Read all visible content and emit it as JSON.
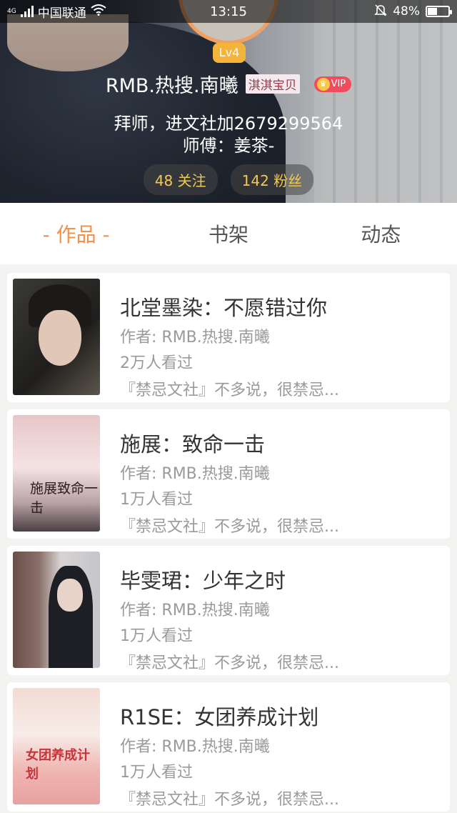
{
  "status_bar": {
    "network": "4G",
    "carrier": "中国联通",
    "time": "13:15",
    "battery_percent": "48%",
    "battery_level": 0.48,
    "icons": [
      "signal-icon",
      "wifi-icon",
      "mute-bell-icon",
      "battery-icon"
    ]
  },
  "profile": {
    "level": "Lv4",
    "username": "RMB.热搜.南曦",
    "nickname_tag": "淇淇宝贝",
    "vip_label": "VIP",
    "bio_line1": "拜师，进文社加2679299564",
    "bio_line2": "师傅：姜茶-",
    "following": "48 关注",
    "followers": "142 粉丝"
  },
  "tabs": [
    {
      "label": "- 作品 -",
      "active": true
    },
    {
      "label": "书架",
      "active": false
    },
    {
      "label": "动态",
      "active": false
    }
  ],
  "books": [
    {
      "title": "北堂墨染：不愿错过你",
      "author": "作者: RMB.热搜.南曦",
      "views": "2万人看过",
      "desc": "『禁忌文社』不多说，很禁忌..."
    },
    {
      "title": "施展：致命一击",
      "author": "作者: RMB.热搜.南曦",
      "views": "1万人看过",
      "desc": "『禁忌文社』不多说，很禁忌...",
      "cover_text": "施展致命一击"
    },
    {
      "title": "毕雯珺：少年之时",
      "author": "作者: RMB.热搜.南曦",
      "views": "1万人看过",
      "desc": "『禁忌文社』不多说，很禁忌..."
    },
    {
      "title": "R1SE：女团养成计划",
      "author": "作者: RMB.热搜.南曦",
      "views": "1万人看过",
      "desc": "『禁忌文社』不多说，很禁忌...",
      "cover_text": "女团养成计划"
    }
  ],
  "colors": {
    "accent": "#f2914c",
    "level_badge": "#f2b43a",
    "stat_text": "#f4c84a",
    "vip": "#f04c5e"
  }
}
